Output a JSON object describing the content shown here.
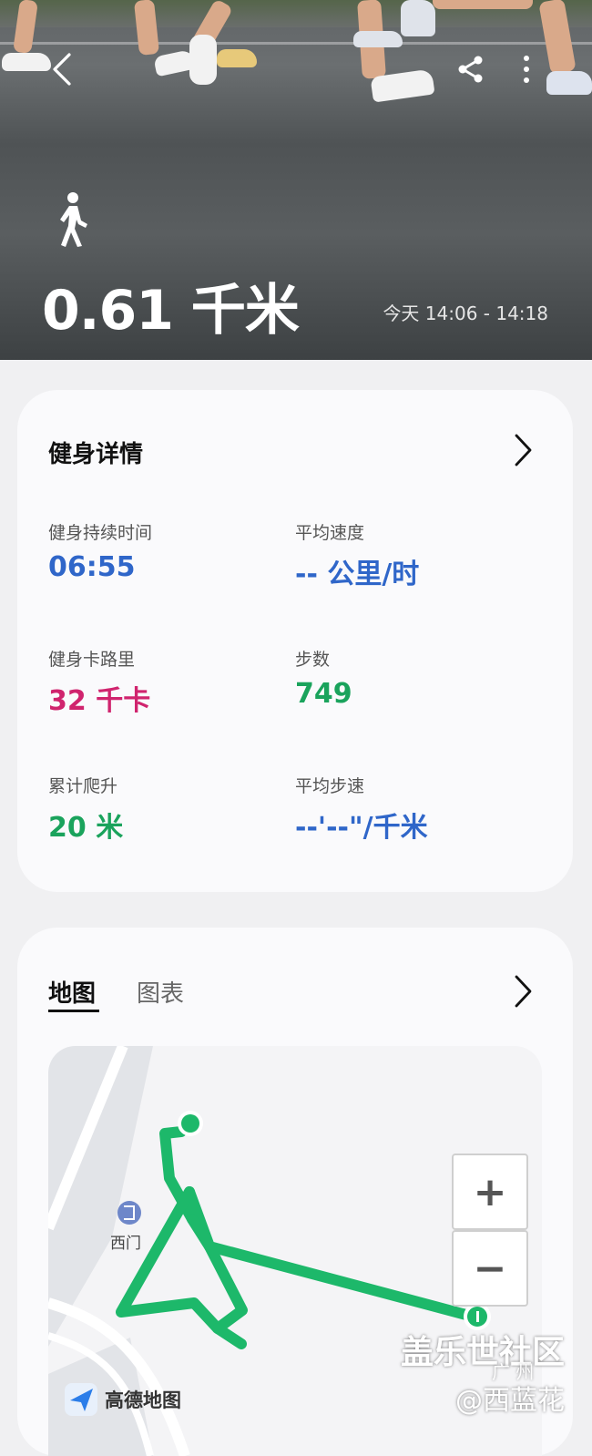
{
  "hero": {
    "distance": "0.61 千米",
    "time_range": "今天 14:06 - 14:18",
    "icons": [
      "back-icon",
      "share-icon",
      "more-icon",
      "walking-icon"
    ]
  },
  "details": {
    "title": "健身详情",
    "stats": [
      {
        "label": "健身持续时间",
        "value": "06:55",
        "color": "#2f66c9"
      },
      {
        "label": "平均速度",
        "value": "-- 公里/时",
        "color": "#2f66c9"
      },
      {
        "label": "健身卡路里",
        "value": "32 千卡",
        "color": "#d0246e"
      },
      {
        "label": "步数",
        "value": "749",
        "color": "#1aa35c"
      },
      {
        "label": "累计爬升",
        "value": "20 米",
        "color": "#1aa35c"
      },
      {
        "label": "平均步速",
        "value": "--'--\"/千米",
        "color": "#2f66c9"
      }
    ]
  },
  "map_section": {
    "tabs": [
      {
        "label": "地图",
        "active": true
      },
      {
        "label": "图表",
        "active": false
      }
    ],
    "poi_label": "西门",
    "zoom_in": "+",
    "zoom_out": "−",
    "map_provider": "高德地图",
    "route_color": "#1db86a"
  },
  "watermark": {
    "line1": "盖乐世社区",
    "line2": "@西蓝花",
    "partial": "广 州"
  }
}
